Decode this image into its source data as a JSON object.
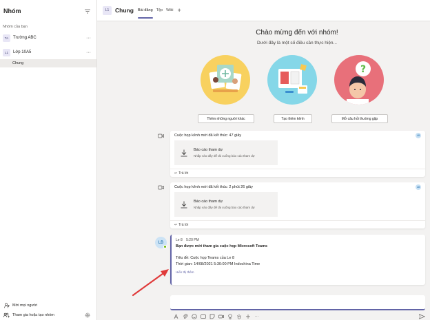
{
  "sidebar": {
    "title": "Nhóm",
    "section_label": "Nhóm của bạn",
    "teams": [
      {
        "initials": "TA",
        "name": "Trường ABC"
      },
      {
        "initials": "L1",
        "name": "Lớp 10A5"
      }
    ],
    "active_channel": "Chung",
    "invite_label": "Mời mọi người",
    "join_create_label": "Tham gia hoặc tạo nhóm"
  },
  "header": {
    "initials": "L1",
    "channel_name": "Chung",
    "tabs": [
      "Bài đăng",
      "Tệp",
      "Wiki"
    ],
    "add_tab": "+"
  },
  "welcome": {
    "title": "Chào mừng đến với nhóm!",
    "subtitle": "Dưới đây là một số điều cần thực hiện...",
    "buttons": [
      "Thêm những người khác",
      "Tạo thêm kênh",
      "Mở câu hỏi thường gặp"
    ]
  },
  "posts": [
    {
      "meeting_text": "Cuộc họp kênh mới đã kết thúc: 47 giây",
      "initials": "L8",
      "card_title": "Báo cáo tham dự",
      "card_sub": "Nhấp vào đây để tải xuống báo cáo tham dự",
      "reply": "Trả lời"
    },
    {
      "meeting_text": "Cuộc họp kênh mới đã kết thúc: 2 phút 26 giây",
      "initials": "L8",
      "card_title": "Báo cáo tham dự",
      "card_sub": "Nhấp vào đây để tải xuống báo cáo tham dự",
      "reply": "Trả lời"
    }
  ],
  "invite_post": {
    "avatar": "LB",
    "author": "Le 8",
    "time": "5:20 PM",
    "title": "Bạn được mời tham gia cuộc họp Microsoft Teams",
    "subject_line": "Tiêu đề: Cuộc họp Teams của Le 8",
    "time_line": "Thời gian: 14/08/2021 5:30:00 PM Indochina Time",
    "more_link": "Hiển thị thêm"
  },
  "colors": {
    "accent": "#6264a7",
    "annotation_arrow": "#e03a3a"
  }
}
